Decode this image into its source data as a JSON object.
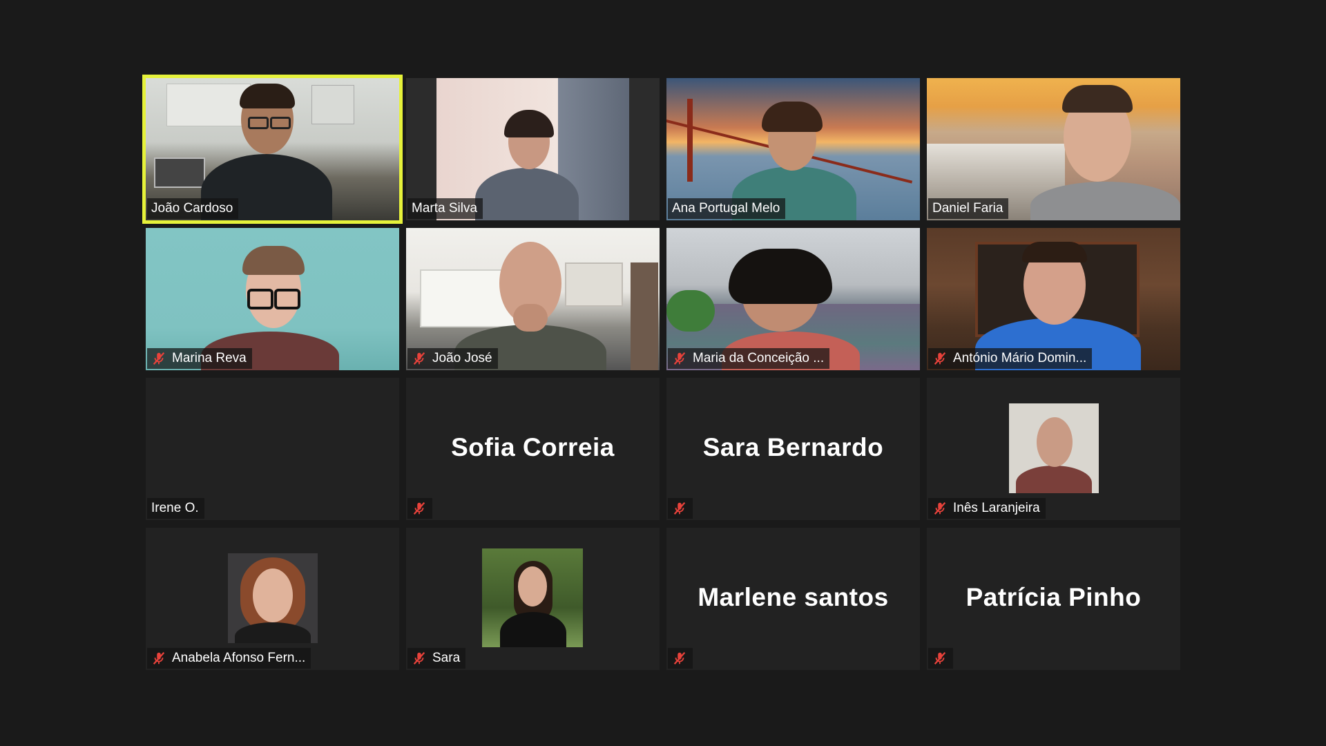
{
  "meeting": {
    "participants": [
      {
        "name": "João Cardoso",
        "muted": false,
        "active_speaker": true,
        "video": "on"
      },
      {
        "name": "Marta Silva",
        "muted": false,
        "active_speaker": false,
        "video": "on"
      },
      {
        "name": "Ana Portugal Melo",
        "muted": false,
        "active_speaker": false,
        "video": "on"
      },
      {
        "name": "Daniel Faria",
        "muted": false,
        "active_speaker": false,
        "video": "on"
      },
      {
        "name": "Marina Reva",
        "muted": true,
        "active_speaker": false,
        "video": "on"
      },
      {
        "name": "João José",
        "muted": true,
        "active_speaker": false,
        "video": "on"
      },
      {
        "name": "Maria da Conceição ...",
        "muted": true,
        "active_speaker": false,
        "video": "on"
      },
      {
        "name": "António Mário Domin...",
        "muted": true,
        "active_speaker": false,
        "video": "on"
      },
      {
        "name": "Irene O.",
        "muted": false,
        "active_speaker": false,
        "video": "off"
      },
      {
        "name": "Sofia Correia",
        "muted": true,
        "active_speaker": false,
        "video": "off",
        "name_in_plate": false
      },
      {
        "name": "Sara Bernardo",
        "muted": true,
        "active_speaker": false,
        "video": "off",
        "name_in_plate": false
      },
      {
        "name": "Inês Laranjeira",
        "muted": true,
        "active_speaker": false,
        "video": "photo"
      },
      {
        "name": "Anabela Afonso Fern...",
        "muted": true,
        "active_speaker": false,
        "video": "photo"
      },
      {
        "name": "Sara",
        "muted": true,
        "active_speaker": false,
        "video": "photo"
      },
      {
        "name": "Marlene santos",
        "muted": true,
        "active_speaker": false,
        "video": "off",
        "name_in_plate": false
      },
      {
        "name": "Patrícia Pinho",
        "muted": true,
        "active_speaker": false,
        "video": "off",
        "name_in_plate": false
      }
    ]
  },
  "colors": {
    "background": "#1a1a1a",
    "tile": "#222222",
    "active_speaker_border": "#e6f23a",
    "muted_icon": "#e8423b",
    "text": "#ffffff"
  },
  "icons": {
    "muted": "microphone-muted-icon"
  }
}
